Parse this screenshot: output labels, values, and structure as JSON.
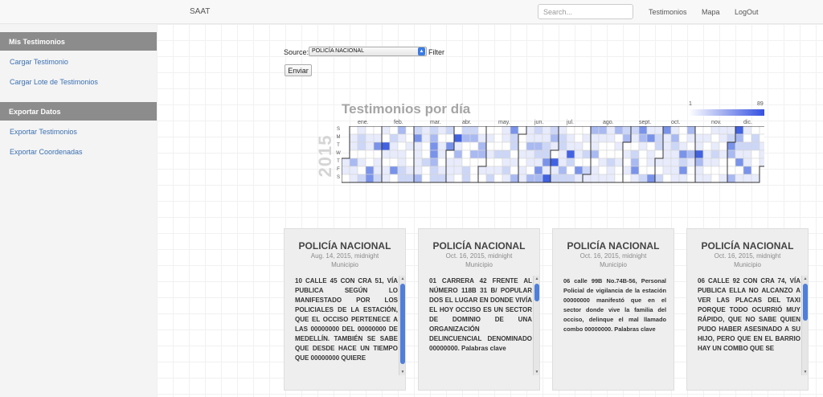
{
  "header": {
    "brand": "SAAT",
    "search_placeholder": "Search...",
    "nav": [
      "Testimonios",
      "Mapa",
      "LogOut"
    ]
  },
  "sidebar": {
    "sections": [
      {
        "title": "Mis Testimonios",
        "items": [
          "Cargar Testimonio",
          "Cargar Lote de Testimonios"
        ]
      },
      {
        "title": "Exportar Datos",
        "items": [
          "Exportar Testimonios",
          "Exportar Coordenadas"
        ]
      }
    ]
  },
  "filter": {
    "source_label": "Source:",
    "selected_source": "POLICÍA NACIONAL",
    "filter_label": "Filter",
    "submit_label": "Enviar"
  },
  "calendar": {
    "title": "Testimonios por día",
    "year": "2015",
    "legend_min": "1",
    "legend_max": "89",
    "day_labels": [
      "S",
      "M",
      "T",
      "W",
      "T",
      "F",
      "S"
    ],
    "months": [
      "ene.",
      "feb.",
      "mar.",
      "abr.",
      "may.",
      "jun.",
      "jul.",
      "ago.",
      "sept.",
      "oct.",
      "nov.",
      "dic."
    ],
    "colors": [
      "#ffffff",
      "#e7ebfb",
      "#ccd6f7",
      "#a9b9f2",
      "#7a93ea",
      "#4262e2"
    ]
  },
  "cards": [
    {
      "source": "POLICÍA NACIONAL",
      "date": "Aug. 14, 2015, midnight",
      "municipio": "Municipio",
      "text": "10 CALLE 45 CON CRA 51, VÍA PUBLICA SEGÚN LO MANIFESTADO POR LOS POLICIALES DE LA ESTACIÓN, QUE EL OCCISO PERTENECE A LAS 00000000 DEL 00000000 DE MEDELLÍN. TAMBIÉN SE SABE QUE DESDE HACE UN TIEMPO QUE 00000000 QUIERE"
    },
    {
      "source": "POLICÍA NACIONAL",
      "date": "Oct. 16, 2015, midnight",
      "municipio": "Municipio",
      "text": "01 CARRERA 42 FRENTE AL NÚMERO 118B 31 B/ POPULAR DOS EL LUGAR EN DONDE VIVÍA EL HOY OCCISO ES UN SECTOR DE DOMINIO DE UNA ORGANIZACIÓN DELINCUENCIAL DENOMINADO 00000000. Palabras clave"
    },
    {
      "source": "POLICÍA NACIONAL",
      "date": "Oct. 16, 2015, midnight",
      "municipio": "Municipio",
      "text": "06 calle 99B No.74B-56, Personal Policial de vigilancia de la estación 00000000 manifestó que en el sector donde vive la familia del occiso, delinque el mal llamado combo 00000000. Palabras clave"
    },
    {
      "source": "POLICÍA NACIONAL",
      "date": "Oct. 16, 2015, midnight",
      "municipio": "Municipio",
      "text": "06 CALLE 92 CON CRA 74, VÍA PUBLICA ELLA NO ALCANZO A VER LAS PLACAS DEL TAXI PORQUE TODO OCURRIÓ MUY RÁPIDO, QUE NO SABE QUIEN PUDO HABER ASESINADO A SU HIJO, PERO QUE EN EL BARRIO HAY UN COMBO QUE SE"
    }
  ]
}
